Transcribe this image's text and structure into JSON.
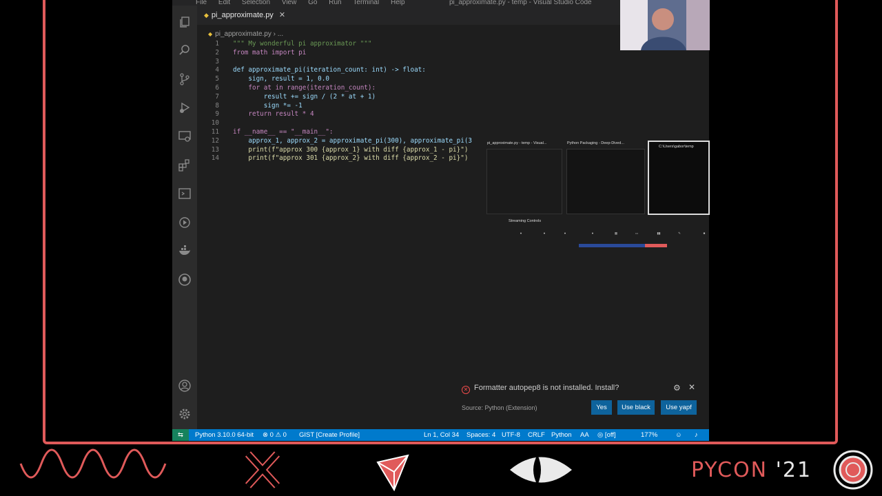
{
  "menubar": {
    "items": [
      "File",
      "Edit",
      "Selection",
      "View",
      "Go",
      "Run",
      "Terminal",
      "Help"
    ],
    "window_title": "pi_approximate.py - temp - Visual Studio Code"
  },
  "editor": {
    "tab_label": "pi_approximate.py",
    "breadcrumb_file": "pi_approximate.py",
    "breadcrumb_rest": "›  ...",
    "lines": [
      {
        "n": "1",
        "text": "\"\"\" My wonderful pi approximator \"\"\""
      },
      {
        "n": "2",
        "text": "from math import pi"
      },
      {
        "n": "3",
        "text": ""
      },
      {
        "n": "4",
        "text": "def approximate_pi(iteration_count: int) -> float:"
      },
      {
        "n": "5",
        "text": "    sign, result = 1, 0.0"
      },
      {
        "n": "6",
        "text": "    for at in range(iteration_count):"
      },
      {
        "n": "7",
        "text": "        result += sign / (2 * at + 1)"
      },
      {
        "n": "8",
        "text": "        sign *= -1"
      },
      {
        "n": "9",
        "text": "    return result * 4"
      },
      {
        "n": "10",
        "text": ""
      },
      {
        "n": "11",
        "text": "if __name__ == \"__main__\":"
      },
      {
        "n": "12",
        "text": "    approx_1, approx_2 = approximate_pi(300), approximate_pi(3"
      },
      {
        "n": "13",
        "text": "    print(f\"approx 300 {approx_1} with diff {approx_1 - pi}\")"
      },
      {
        "n": "14",
        "text": "    print(f\"approx 301 {approx_2} with diff {approx_2 - pi}\")"
      }
    ]
  },
  "task_switcher": {
    "win1_title": "pi_approximate.py - temp - Visual...",
    "win2_title": "Python Packaging - Deep-Dived...",
    "win3_title": "C:\\Users\\gabor\\temp",
    "stream_panel_title": "Streaming Controls"
  },
  "notification": {
    "message": "Formatter autopep8 is not installed. Install?",
    "source": "Source: Python (Extension)",
    "buttons": [
      "Yes",
      "Use black",
      "Use yapf"
    ]
  },
  "statusbar": {
    "interpreter": "Python 3.10.0 64-bit",
    "problems": "⊗ 0 ⚠ 0",
    "gist": "GIST [Create Profile]",
    "position": "Ln 1, Col 34",
    "spaces": "Spaces: 4",
    "encoding": "UTF-8",
    "eol": "CRLF",
    "language": "Python",
    "font_size": "AA",
    "live_share": "◎ [off]",
    "zoom": "177%"
  },
  "branding": {
    "pycon": "PYCON",
    "year": "'21"
  },
  "colors": {
    "frame": "#e05a5a",
    "statusbar": "#007acc",
    "button": "#0e639c"
  }
}
